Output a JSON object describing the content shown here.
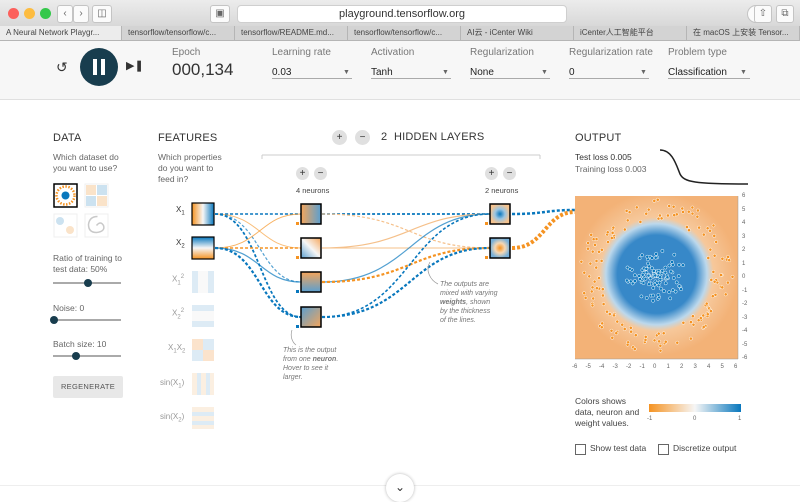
{
  "browser": {
    "address": "playground.tensorflow.org",
    "tabs": [
      {
        "label": "A Neural Network Playgr...",
        "active": true
      },
      {
        "label": "tensorflow/tensorflow/c..."
      },
      {
        "label": "tensorflow/README.md..."
      },
      {
        "label": "tensorflow/tensorflow/c..."
      },
      {
        "label": "AI云 - iCenter Wiki"
      },
      {
        "label": "iCenter人工智能平台"
      },
      {
        "label": "在 macOS 上安装 Tensor..."
      }
    ]
  },
  "controls": {
    "epoch_label": "Epoch",
    "epoch_value": "000,134",
    "learning_rate_label": "Learning rate",
    "learning_rate_value": "0.03",
    "activation_label": "Activation",
    "activation_value": "Tanh",
    "regularization_label": "Regularization",
    "regularization_value": "None",
    "regularization_rate_label": "Regularization rate",
    "regularization_rate_value": "0",
    "problem_type_label": "Problem type",
    "problem_type_value": "Classification"
  },
  "data_panel": {
    "title": "DATA",
    "question": "Which dataset do you want to use?",
    "ratio_label": "Ratio of training to test data:  50%",
    "ratio_value": 0.5,
    "noise_label": "Noise:  0",
    "noise_value": 0,
    "batch_label": "Batch size:  10",
    "batch_value": 0.34,
    "regenerate": "REGENERATE"
  },
  "features_panel": {
    "title": "FEATURES",
    "question": "Which properties do you want to feed in?",
    "features": [
      {
        "base": "X",
        "sub": "1",
        "sup": ""
      },
      {
        "base": "X",
        "sub": "2",
        "sup": ""
      },
      {
        "base": "X",
        "sub": "1",
        "sup": "2"
      },
      {
        "base": "X",
        "sub": "2",
        "sup": "2"
      },
      {
        "base": "X",
        "sub": "1",
        "sup": "",
        "extra": "X",
        "extra_sub": "2"
      },
      {
        "base": "sin(X",
        "sub": "1",
        "sup": "",
        "tail": ")"
      },
      {
        "base": "sin(X",
        "sub": "2",
        "sup": "",
        "tail": ")"
      }
    ]
  },
  "network": {
    "plus": "+",
    "minus": "−",
    "layers_count": "2",
    "layers_label": "HIDDEN LAYERS",
    "layer1_label": "4 neurons",
    "layer2_label": "2 neurons",
    "note_outputs_1": "The outputs are",
    "note_outputs_2": "mixed with varying",
    "note_outputs_3": "weights",
    "note_outputs_3b": ", shown",
    "note_outputs_4": "by the thickness",
    "note_outputs_5": "of the lines.",
    "note_neuron_1": "This is the output",
    "note_neuron_2": "from one",
    "note_neuron_2b": "neuron",
    "note_neuron_2c": ".",
    "note_neuron_3": "Hover to see it",
    "note_neuron_4": "larger."
  },
  "output_panel": {
    "title": "OUTPUT",
    "test_loss": "Test loss 0.005",
    "training_loss": "Training loss 0.003",
    "y_ticks": [
      "6",
      "5",
      "4",
      "3",
      "2",
      "1",
      "0",
      "-1",
      "-2",
      "-3",
      "-4",
      "-5",
      "-6"
    ],
    "x_ticks": [
      "-6",
      "-5",
      "-4",
      "-3",
      "-2",
      "-1",
      "0",
      "1",
      "2",
      "3",
      "4",
      "5",
      "6"
    ],
    "legend_1": "Colors shows",
    "legend_2": "data, neuron and",
    "legend_3": "weight values.",
    "legend_min": "-1",
    "legend_mid": "0",
    "legend_max": "1",
    "show_test_data": "Show test data",
    "discretize_output": "Discretize output"
  },
  "colors": {
    "orange": "#f59322",
    "blue": "#0877bd",
    "dark_button": "#183d4e"
  }
}
